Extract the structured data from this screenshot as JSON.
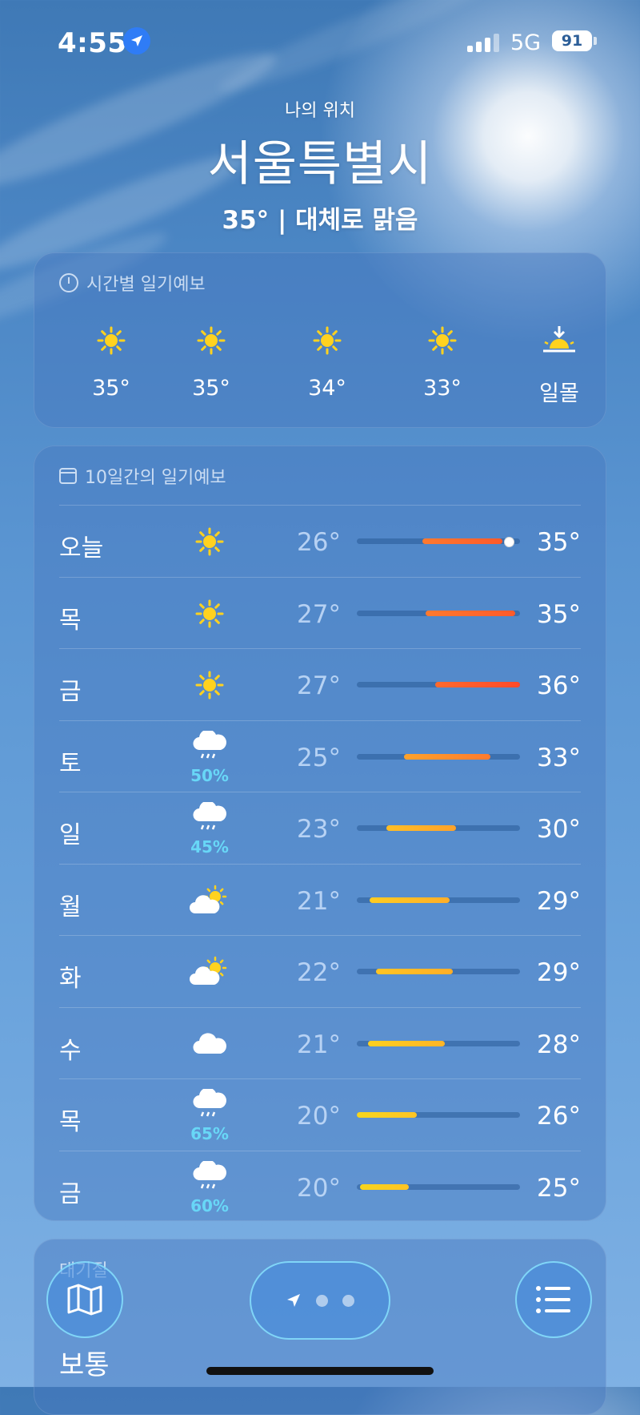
{
  "status_bar": {
    "time": "4:55",
    "network": "5G",
    "battery": "91"
  },
  "location": {
    "label": "나의 위치",
    "city": "서울특별시",
    "summary": "35°  |  대체로 맑음"
  },
  "hourly": {
    "title": "시간별 일기예보",
    "items": [
      {
        "icon": "sun-icon",
        "value": "35°"
      },
      {
        "icon": "sun-icon",
        "value": "35°"
      },
      {
        "icon": "sun-icon",
        "value": "34°"
      },
      {
        "icon": "sun-icon",
        "value": "33°"
      },
      {
        "icon": "sunset-icon",
        "value": "일몰"
      }
    ]
  },
  "daily": {
    "title": "10일간의 일기예보",
    "days": [
      {
        "day": "오늘",
        "icon": "sun-icon",
        "precip": "",
        "low": "26°",
        "high": "35°",
        "range_start": 0.4,
        "range_end": 0.89,
        "color_from": "#ff7a2e",
        "color_to": "#ff5a2a",
        "current": 0.93
      },
      {
        "day": "목",
        "icon": "sun-icon",
        "precip": "",
        "low": "27°",
        "high": "35°",
        "range_start": 0.42,
        "range_end": 0.97,
        "color_from": "#ff7a2e",
        "color_to": "#ff5a2a"
      },
      {
        "day": "금",
        "icon": "sun-icon",
        "precip": "",
        "low": "27°",
        "high": "36°",
        "range_start": 0.48,
        "range_end": 1.0,
        "color_from": "#ff6a2c",
        "color_to": "#ff4a2a"
      },
      {
        "day": "토",
        "icon": "rain-cloud-icon",
        "precip": "50%",
        "low": "25°",
        "high": "33°",
        "range_start": 0.29,
        "range_end": 0.82,
        "color_from": "#ffa22a",
        "color_to": "#ff7a2e"
      },
      {
        "day": "일",
        "icon": "rain-cloud-icon",
        "precip": "45%",
        "low": "23°",
        "high": "30°",
        "range_start": 0.18,
        "range_end": 0.61,
        "color_from": "#ffbe26",
        "color_to": "#ffa22a"
      },
      {
        "day": "월",
        "icon": "partly-sunny-icon",
        "precip": "",
        "low": "21°",
        "high": "29°",
        "range_start": 0.08,
        "range_end": 0.57,
        "color_from": "#ffcc22",
        "color_to": "#ffae28"
      },
      {
        "day": "화",
        "icon": "partly-sunny-icon",
        "precip": "",
        "low": "22°",
        "high": "29°",
        "range_start": 0.12,
        "range_end": 0.59,
        "color_from": "#ffc424",
        "color_to": "#ffae28"
      },
      {
        "day": "수",
        "icon": "cloud-icon",
        "precip": "",
        "low": "21°",
        "high": "28°",
        "range_start": 0.07,
        "range_end": 0.54,
        "color_from": "#ffd020",
        "color_to": "#ffb426"
      },
      {
        "day": "목",
        "icon": "rain-cloud-icon",
        "precip": "65%",
        "low": "20°",
        "high": "26°",
        "range_start": 0.0,
        "range_end": 0.37,
        "color_from": "#f5d51e",
        "color_to": "#ffc424"
      },
      {
        "day": "금",
        "icon": "rain-cloud-icon",
        "precip": "60%",
        "low": "20°",
        "high": "25°",
        "range_start": 0.02,
        "range_end": 0.32,
        "color_from": "#f5d51e",
        "color_to": "#ffc424"
      }
    ]
  },
  "air_quality": {
    "title": "대기질",
    "value": "보통"
  }
}
